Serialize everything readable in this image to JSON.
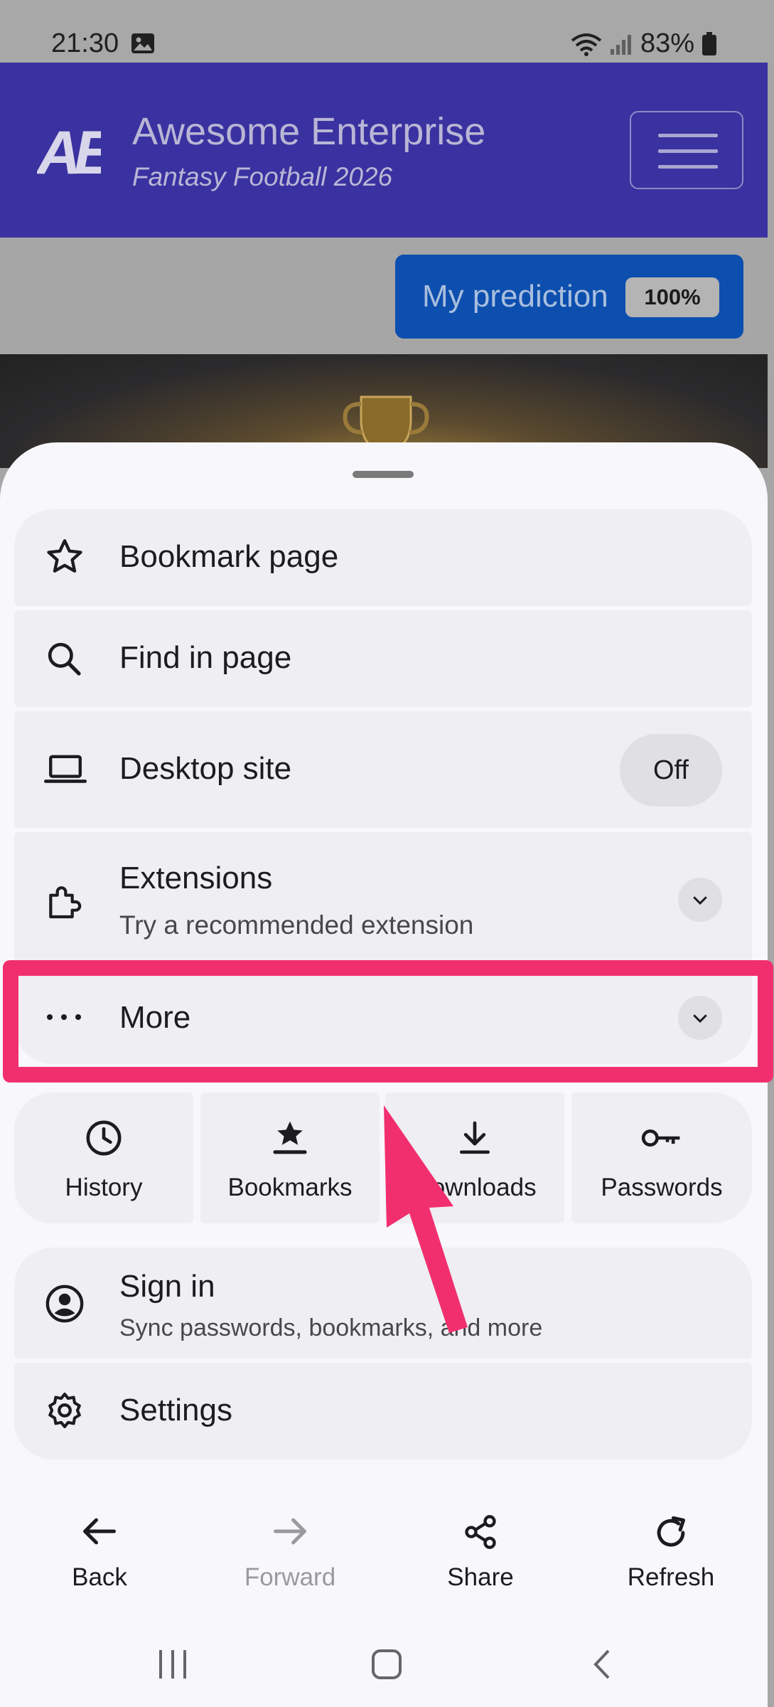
{
  "status_bar": {
    "time": "21:30",
    "battery": "83%"
  },
  "site": {
    "logo_text": "AE",
    "title": "Awesome Enterprise",
    "subtitle": "Fantasy Football 2026",
    "prediction_label": "My prediction",
    "prediction_badge": "100%"
  },
  "menu": {
    "bookmark_page": "Bookmark page",
    "find_in_page": "Find in page",
    "desktop_site": "Desktop site",
    "desktop_site_state": "Off",
    "extensions": "Extensions",
    "extensions_sub": "Try a recommended extension",
    "more": "More",
    "tiles": [
      "History",
      "Bookmarks",
      "Downloads",
      "Passwords"
    ],
    "sign_in": "Sign in",
    "sign_in_sub": "Sync passwords, bookmarks, and more",
    "settings": "Settings"
  },
  "nav": {
    "back": "Back",
    "forward": "Forward",
    "share": "Share",
    "refresh": "Refresh"
  },
  "colors": {
    "header": "#3a32a0",
    "highlight": "#f22f6e",
    "prediction_button": "#0c4fae"
  }
}
